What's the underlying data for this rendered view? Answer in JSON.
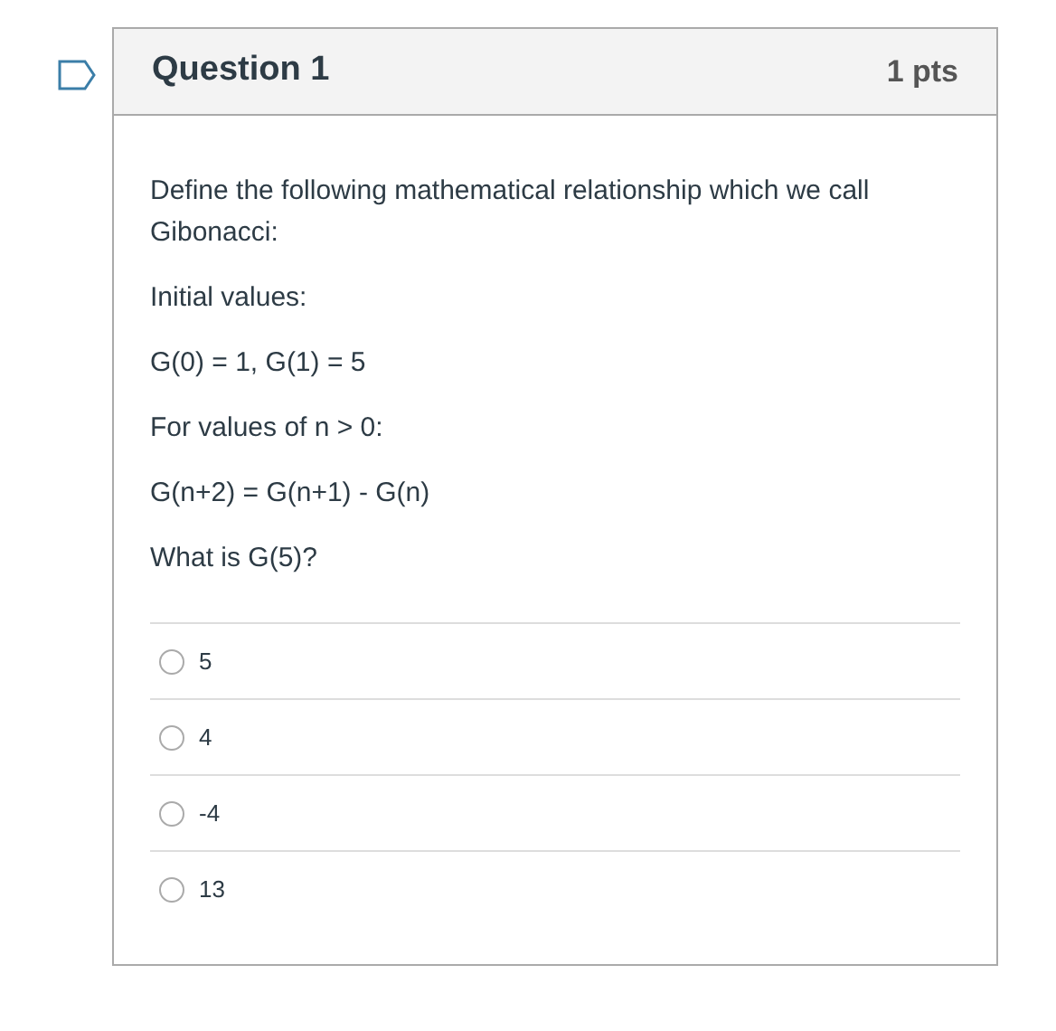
{
  "question": {
    "title": "Question 1",
    "points": "1 pts",
    "paragraphs": [
      "Define the following mathematical relationship which we call Gibonacci:",
      "Initial values:",
      "G(0) = 1, G(1) = 5",
      "For values of n > 0:",
      "G(n+2) = G(n+1) - G(n)",
      "What is G(5)?"
    ],
    "answers": [
      {
        "label": "5",
        "selected": false
      },
      {
        "label": "4",
        "selected": false
      },
      {
        "label": "-4",
        "selected": false
      },
      {
        "label": "13",
        "selected": false
      }
    ]
  }
}
